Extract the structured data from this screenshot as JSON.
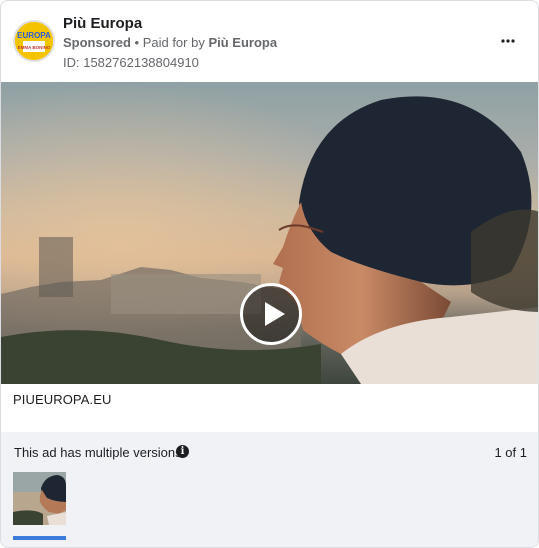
{
  "ad": {
    "page_name": "Più Europa",
    "sponsored": "Sponsored",
    "separator": " • ",
    "paid_for_prefix": "Paid for by ",
    "payer": "Più Europa",
    "id_text": "ID: 1582762138804910",
    "more_icon": "more-horizontal-icon",
    "avatar_top_text": "EUROPA",
    "avatar_bottom_text": "EMMA BONINO"
  },
  "media": {
    "type": "video",
    "play_icon": "play-icon",
    "link_caption": "PIUEUROPA.EU"
  },
  "versions": {
    "label": "This ad has multiple versions",
    "info_icon": "info-icon",
    "info_glyph": "i",
    "pager": "1 of 1"
  },
  "colors": {
    "accent_blue": "#3b7cdb",
    "avatar_yellow": "#f5c400",
    "avatar_blue": "#2a5bd7",
    "muted_text": "#65676b",
    "versions_bg": "#f0f2f5"
  }
}
